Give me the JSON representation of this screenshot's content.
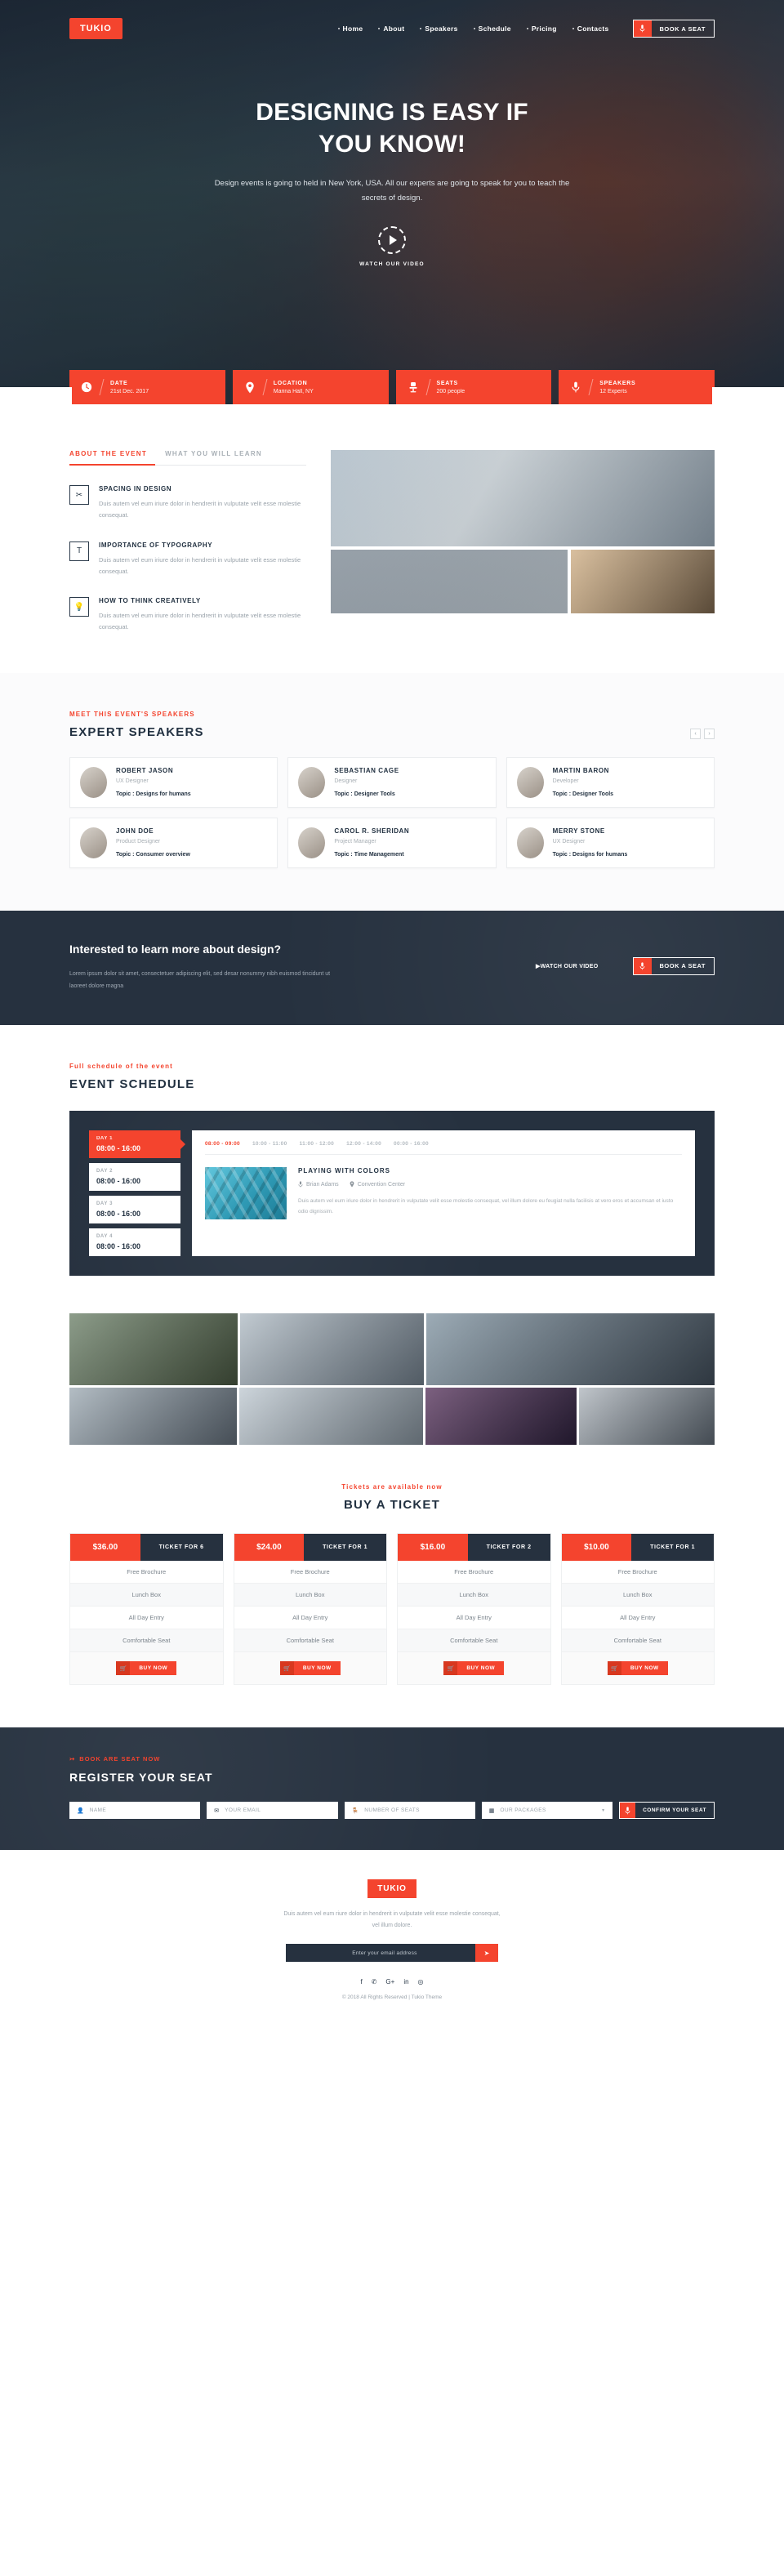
{
  "brand": {
    "name": "TUKIO",
    "accent": "#f4442e",
    "dark": "#26313f"
  },
  "nav": {
    "items": [
      {
        "label": "Home"
      },
      {
        "label": "About"
      },
      {
        "label": "Speakers"
      },
      {
        "label": "Schedule"
      },
      {
        "label": "Pricing"
      },
      {
        "label": "Contacts"
      }
    ],
    "cta": {
      "label": "BOOK A SEAT",
      "icon": "microphone-icon"
    }
  },
  "hero": {
    "title_line1": "DESIGNING IS EASY IF",
    "title_line2": "YOU KNOW!",
    "subtitle": "Design events is going to held in New York, USA. All our experts are going to speak for you to teach the secrets of design.",
    "watch_label": "WATCH OUR VIDEO"
  },
  "info_cards": [
    {
      "icon": "clock-icon",
      "title": "DATE",
      "value": "21st Dec. 2017"
    },
    {
      "icon": "map-pin-icon",
      "title": "LOCATION",
      "value": "Marina Hall, NY"
    },
    {
      "icon": "chair-icon",
      "title": "SEATS",
      "value": "200 people"
    },
    {
      "icon": "microphone-icon",
      "title": "SPEAKERS",
      "value": "12 Experts"
    }
  ],
  "about": {
    "tabs": [
      {
        "label": "ABOUT THE EVENT",
        "active": true
      },
      {
        "label": "WHAT YOU WILL LEARN",
        "active": false
      }
    ],
    "features": [
      {
        "icon": "scissors-icon",
        "title": "SPACING IN DESIGN",
        "text": "Duis autem vel eum iriure dolor in hendrerit in vulputate velit esse molestie consequat."
      },
      {
        "icon": "typography-icon",
        "title": "IMPORTANCE OF TYPOGRAPHY",
        "text": "Duis autem vel eum iriure dolor in hendrerit in vulputate velit esse molestie consequat."
      },
      {
        "icon": "lightbulb-icon",
        "title": "HOW TO THINK CREATIVELY",
        "text": "Duis autem vel eum iriure dolor in hendrerit in vulputate velit esse molestie consequat."
      }
    ]
  },
  "speakers": {
    "kicker": "MEET THIS EVENT'S SPEAKERS",
    "title": "EXPERT SPEAKERS",
    "prev": "‹",
    "next": "›",
    "list": [
      {
        "name": "ROBERT JASON",
        "role": "UX Designer",
        "topic": "Topic : Designs for humans"
      },
      {
        "name": "SEBASTIAN CAGE",
        "role": "Designer",
        "topic": "Topic : Designer Tools"
      },
      {
        "name": "MARTIN BARON",
        "role": "Developer",
        "topic": "Topic : Designer Tools"
      },
      {
        "name": "JOHN DOE",
        "role": "Product Designer",
        "topic": "Topic : Consumer overview"
      },
      {
        "name": "CAROL R. SHERIDAN",
        "role": "Project Manager",
        "topic": "Topic : Time Management"
      },
      {
        "name": "MERRY STONE",
        "role": "UX Designer",
        "topic": "Topic : Designs for humans"
      }
    ]
  },
  "cta": {
    "heading": "Interested to learn more about design?",
    "paragraph": "Lorem ipsum dolor sit amet, consectetuer adipiscing elit, sed desar nonummy nibh euismod tincidunt ut laoreet dolore magna",
    "watch_label": "▶WATCH OUR VIDEO",
    "button": {
      "label": "BOOK A SEAT",
      "icon": "microphone-icon"
    }
  },
  "schedule": {
    "kicker": "Full schedule of the event",
    "title": "EVENT SCHEDULE",
    "days": [
      {
        "day": "DAY 1",
        "hours": "08:00 - 16:00",
        "active": true
      },
      {
        "day": "DAY 2",
        "hours": "08:00 - 16:00",
        "active": false
      },
      {
        "day": "DAY 3",
        "hours": "08:00 - 16:00",
        "active": false
      },
      {
        "day": "DAY 4",
        "hours": "08:00 - 16:00",
        "active": false
      }
    ],
    "slots": [
      {
        "label": "08:00 - 09:00",
        "active": true
      },
      {
        "label": "10:00 - 11:00",
        "active": false
      },
      {
        "label": "11:00 - 12:00",
        "active": false
      },
      {
        "label": "12:00 - 14:00",
        "active": false
      },
      {
        "label": "00:00 - 16:00",
        "active": false
      }
    ],
    "session": {
      "title": "PLAYING WITH COLORS",
      "speaker": "Brian Adams",
      "venue": "Convention Center",
      "description": "Duis autem vel eum iriure dolor in hendrerit in vulputate velit esse molestie consequat, vel illum dolore eu feugiat nulla facilisis at vero eros et accumsan et iusto odio dignissim."
    }
  },
  "pricing": {
    "kicker": "Tickets are available now",
    "title": "BUY A TICKET",
    "features": [
      "Free Brochure",
      "Lunch Box",
      "All Day Entry",
      "Comfortable Seat"
    ],
    "buy_label": "BUY NOW",
    "plans": [
      {
        "price": "$36.00",
        "label": "TICKET FOR 6"
      },
      {
        "price": "$24.00",
        "label": "TICKET FOR 1"
      },
      {
        "price": "$16.00",
        "label": "TICKET FOR 2"
      },
      {
        "price": "$10.00",
        "label": "TICKET FOR 1"
      }
    ]
  },
  "register": {
    "kicker": "BOOK ARE SEAT NOW",
    "title": "REGISTER YOUR SEAT",
    "fields": [
      {
        "icon": "user-icon",
        "placeholder": "NAME"
      },
      {
        "icon": "envelope-icon",
        "placeholder": "YOUR EMAIL"
      },
      {
        "icon": "chair-icon",
        "placeholder": "NUMBER OF SEATS"
      },
      {
        "icon": "package-icon",
        "placeholder": "OUR PACKAGES"
      }
    ],
    "submit": {
      "label": "CONFIRM YOUR SEAT",
      "icon": "microphone-icon"
    }
  },
  "footer": {
    "logo": "TUKIO",
    "text": "Duis autem vel eum riure dolor in hendrerit in vulputate velit esse molestie consequat, vel illum dolore.",
    "newsletter_placeholder": "Enter your email address",
    "send_icon": "paper-plane-icon",
    "socials": [
      "f",
      "✆",
      "G+",
      "in",
      "◎"
    ],
    "copyright": "© 2018 All Rights Reserved | Tukio Theme"
  }
}
